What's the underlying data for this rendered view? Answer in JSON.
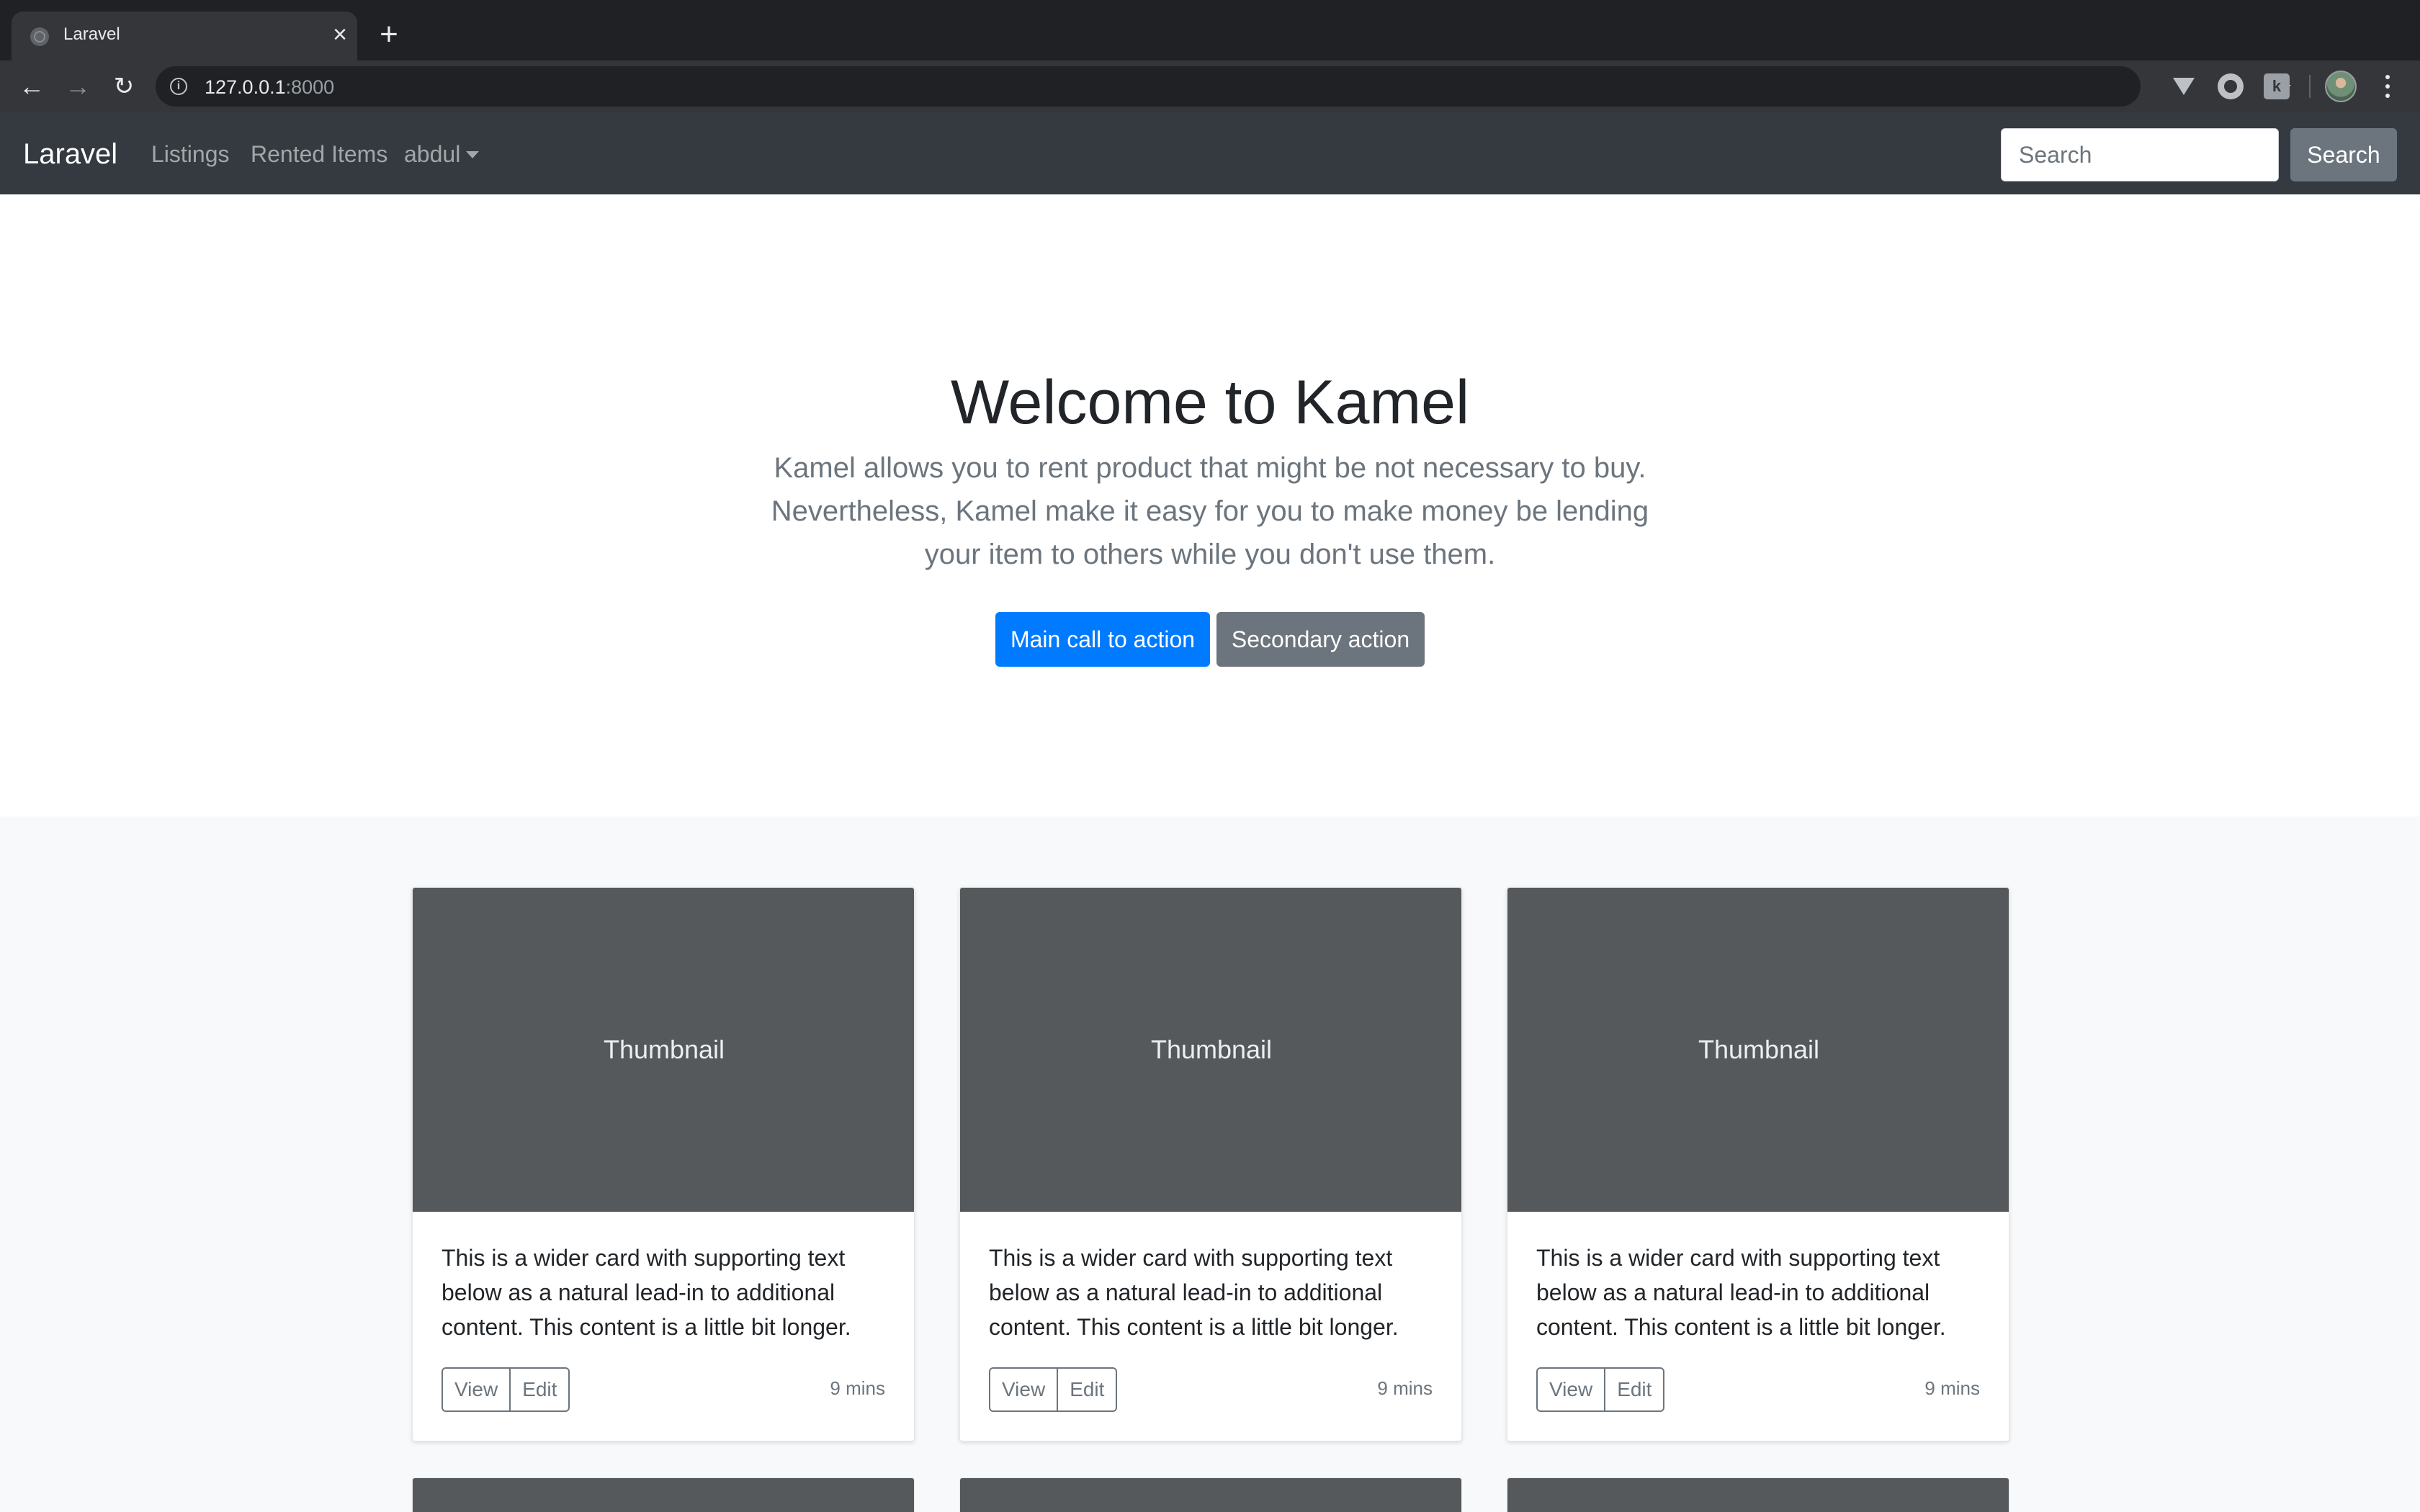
{
  "browser": {
    "tab_title": "Laravel",
    "url_host": "127.0.0.1",
    "url_port": ":8000",
    "icons": [
      "back-arrow-icon",
      "forward-arrow-icon",
      "reload-icon",
      "info-icon",
      "star-icon",
      "extension-icon",
      "profile-avatar",
      "menu-kebab-icon"
    ]
  },
  "navbar": {
    "brand": "Laravel",
    "links": [
      "Listings",
      "Rented Items",
      "abdul"
    ],
    "search_placeholder": "Search",
    "search_button": "Search"
  },
  "hero": {
    "title": "Welcome to Kamel",
    "lead": "Kamel allows you to rent product that might be not necessary to buy. Nevertheless, Kamel make it easy for you to make money be lending your item to others while you don't use them.",
    "primary_action": "Main call to action",
    "secondary_action": "Secondary action"
  },
  "cards": [
    {
      "thumbnail": "Thumbnail",
      "text": "This is a wider card with supporting text below as a natural lead-in to additional content. This content is a little bit longer.",
      "view": "View",
      "edit": "Edit",
      "time": "9 mins"
    },
    {
      "thumbnail": "Thumbnail",
      "text": "This is a wider card with supporting text below as a natural lead-in to additional content. This content is a little bit longer.",
      "view": "View",
      "edit": "Edit",
      "time": "9 mins"
    },
    {
      "thumbnail": "Thumbnail",
      "text": "This is a wider card with supporting text below as a natural lead-in to additional content. This content is a little bit longer.",
      "view": "View",
      "edit": "Edit",
      "time": "9 mins"
    }
  ],
  "colors": {
    "navbar_bg": "#343a40",
    "primary": "#007bff",
    "secondary": "#6c757d",
    "thumbnail_bg": "#55595c"
  }
}
